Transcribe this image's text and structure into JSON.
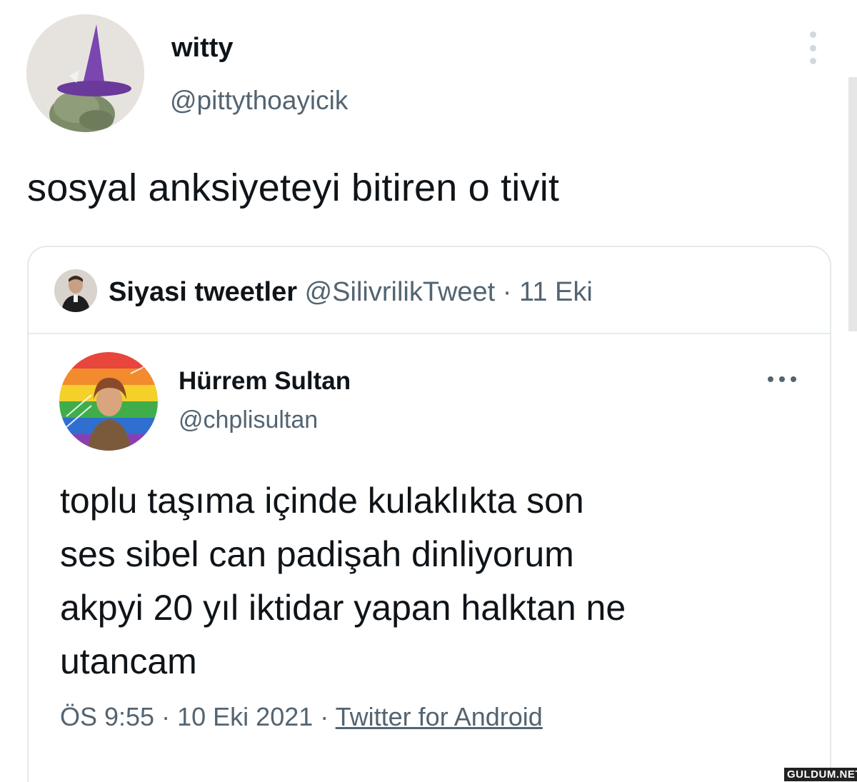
{
  "tweet": {
    "author_name": "witty",
    "author_handle": "@pittythoayicik",
    "text": "sosyal anksiyeteyi bitiren o tivit",
    "more_icon": "more-vertical-icon"
  },
  "quoted": {
    "author_name": "Siyasi tweetler",
    "author_handle": "@SilivrilikTweet",
    "separator": "·",
    "date": "11 Eki"
  },
  "inner": {
    "author_name": "Hürrem Sultan",
    "author_handle": "@chplisultan",
    "more_icon": "more-horizontal-icon",
    "text_lines": [
      "toplu taşıma içinde kulaklıkta son",
      "ses sibel can padişah dinliyorum",
      "akpyi 20 yıl iktidar yapan halktan ne",
      "utancam"
    ],
    "time": "ÖS 9:55",
    "separator": "·",
    "date": "10 Eki 2021",
    "source": "Twitter for Android"
  },
  "watermark": "GULDUM.NET"
}
